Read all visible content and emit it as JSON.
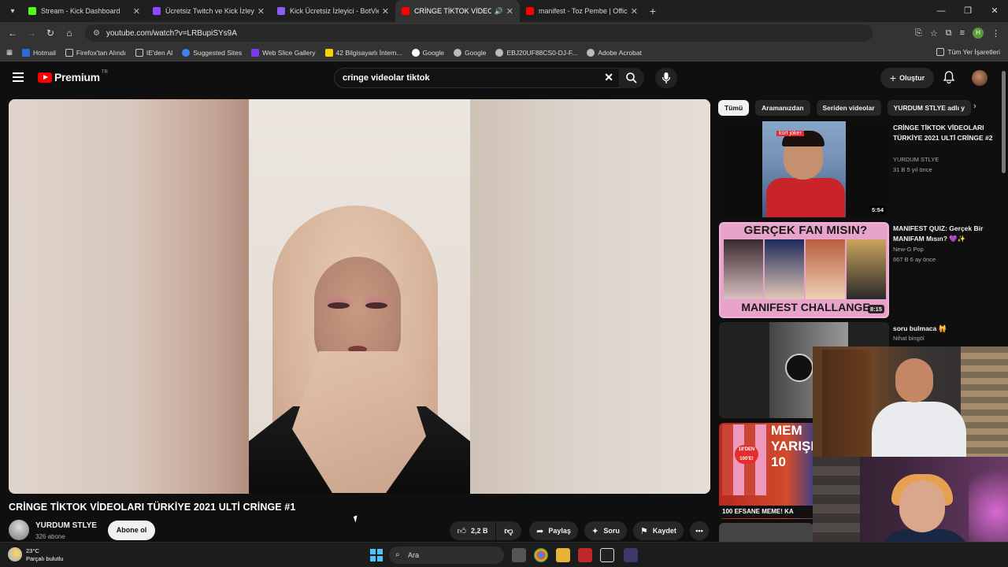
{
  "browser": {
    "tabs": [
      {
        "title": "Stream - Kick Dashboard",
        "color": "#53fc18",
        "active": false
      },
      {
        "title": "Ücretsiz Twitch ve Kick İzleyicile",
        "color": "#9146ff",
        "active": false
      },
      {
        "title": "Kick Ücretsiz İzleyici - BotViewe",
        "color": "#8a5cf6",
        "active": false
      },
      {
        "title": "CRİNGE TİKTOK VİDEOLARI",
        "color": "#ff0000",
        "active": true
      },
      {
        "title": "manifest - Toz Pembe | Official",
        "color": "#ff0000",
        "active": false
      }
    ],
    "url": "youtube.com/watch?v=LRBupiSYs9A",
    "bookmarks": [
      "Hotmail",
      "Firefox'tan Alındı",
      "IE'den Al",
      "Suggested Sites",
      "Web Slice Gallery",
      "42 Bilgisayarlı İntern...",
      "Google",
      "Google",
      "EBJ20UF88CS0-DJ-F...",
      "Adobe Acrobat"
    ],
    "bookmarks_right": "Tüm Yer İşaretleri",
    "profile_initial": "H"
  },
  "youtube": {
    "logo": "Premium",
    "logo_region": "TR",
    "search_query": "cringe videolar tiktok",
    "create_label": "Oluştur",
    "video": {
      "title": "CRİNGE TİKTOK VİDEOLARI TÜRKİYE 2021 ULTİ CRİNGE #1",
      "channel": "YURDUM STLYE",
      "subscribers": "326 abone",
      "subscribe_label": "Abone ol",
      "likes": "2,2 B",
      "share_label": "Paylaş",
      "ask_label": "Soru",
      "save_label": "Kaydet"
    },
    "chips": [
      "Tümü",
      "Aramanızdan",
      "Seriden videolar",
      "YURDUM STLYE adlı y"
    ],
    "recommendations": [
      {
        "title": "CRİNGE TİKTOK VİDEOLARI TÜRKİYE 2021 ULTİ CRİNGE #2",
        "channel": "YURDUM STLYE",
        "meta": "31 B  5 yıl önce",
        "duration": "5:54",
        "thumb_tag": "kürt joker"
      },
      {
        "title": "MANIFEST QUIZ: Gerçek Bir MANIFAM Mısın? 💜✨",
        "channel": "New-G Pop",
        "meta": "667 B  6 ay önce",
        "duration": "8:15",
        "thumb_top": "GERÇEK FAN MISIN?",
        "thumb_bottom": "MANIFEST CHALLANGE"
      },
      {
        "title": "soru bulmaca 🙀",
        "channel": "Nihat bingöl",
        "meta": "",
        "duration": ""
      },
      {
        "title": "",
        "channel": "",
        "meta": "",
        "duration": "",
        "thumb_big": "MEM YARIŞM 10",
        "thumb_bottom": "100 EFSANE MEME! KA",
        "badge": "18'DEN 100'E!"
      }
    ]
  },
  "taskbar": {
    "temperature": "23°C",
    "condition": "Parçalı bulutlu",
    "search_placeholder": "Ara"
  }
}
